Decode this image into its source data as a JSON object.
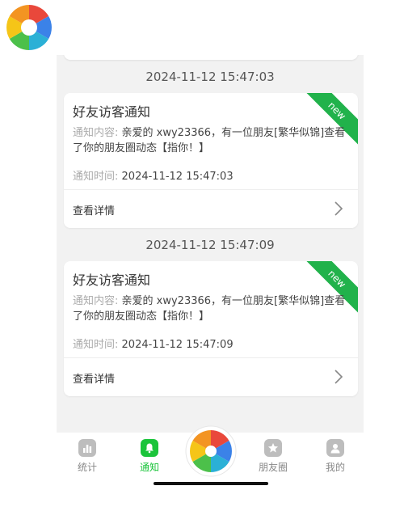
{
  "notices": [
    {
      "timestamp": "2024-11-12 15:47:03",
      "title": "好友访客通知",
      "content_label": "通知内容:",
      "content_text": "亲爱的 xwy23366，有一位朋友[繁华似锦]查看了你的朋友圈动态【指你！】",
      "time_label": "通知时间:",
      "time_value": "2024-11-12 15:47:03",
      "detail_label": "查看详情",
      "badge": "new"
    },
    {
      "timestamp": "2024-11-12 15:47:09",
      "title": "好友访客通知",
      "content_label": "通知内容:",
      "content_text": "亲爱的 xwy23366，有一位朋友[繁华似锦]查看了你的朋友圈动态【指你！】",
      "time_label": "通知时间:",
      "time_value": "2024-11-12 15:47:09",
      "detail_label": "查看详情",
      "badge": "new"
    }
  ],
  "tabbar": {
    "items": [
      {
        "label": "统计",
        "icon": "stats-icon",
        "active": false
      },
      {
        "label": "通知",
        "icon": "bell-icon",
        "active": true
      },
      {
        "label": "",
        "icon": "aperture-logo-icon",
        "active": false
      },
      {
        "label": "朋友圈",
        "icon": "star-icon",
        "active": false
      },
      {
        "label": "我的",
        "icon": "user-icon",
        "active": false
      }
    ]
  },
  "colors": {
    "accent": "#1bc43b",
    "ribbon": "#21b24b",
    "background": "#f2f2f2"
  }
}
